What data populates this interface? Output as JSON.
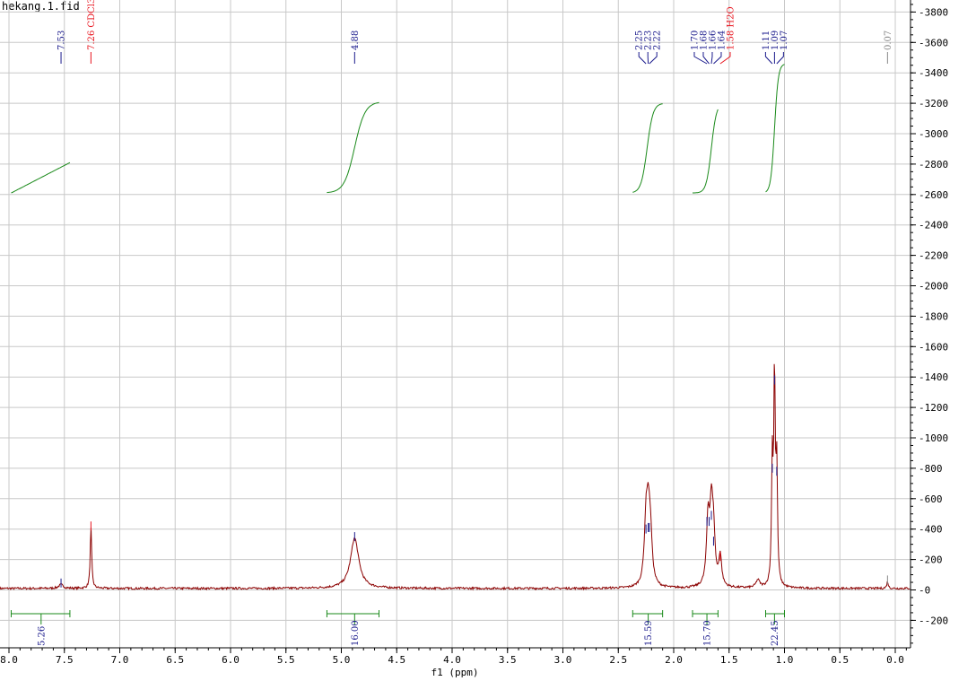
{
  "window_title": "hekang.1.fid",
  "colors": {
    "spectrum": "#8b0000",
    "integral_curve": "#1a8a1a",
    "integral_bar": "#1a8a1a",
    "peak_label_default": "#1a1a8c",
    "peak_label_solvent": "#e8141e",
    "peak_label_reference": "#888888",
    "grid": "#c8c8c8"
  },
  "chart_data": {
    "type": "line",
    "title": "",
    "xlabel": "f1 (ppm)",
    "ylabel": "",
    "xlim": [
      8.05,
      -0.1
    ],
    "ylim": [
      -400,
      3920
    ],
    "x_ticks": [
      "8.0",
      "7.5",
      "7.0",
      "6.5",
      "6.0",
      "5.5",
      "5.0",
      "4.5",
      "4.0",
      "3.5",
      "3.0",
      "2.5",
      "2.0",
      "1.5",
      "1.0",
      "0.5",
      "0.0"
    ],
    "y_ticks": [
      "3800",
      "3600",
      "3400",
      "3200",
      "3000",
      "2800",
      "2600",
      "2400",
      "2200",
      "2000",
      "1800",
      "1600",
      "1400",
      "1200",
      "1000",
      "800",
      "600",
      "400",
      "200",
      "0",
      "-200"
    ],
    "grid": true,
    "peak_labels": [
      {
        "ppm": 7.53,
        "text": "7.53",
        "kind": "default"
      },
      {
        "ppm": 7.26,
        "text": "7.26 CDCl3",
        "kind": "solvent"
      },
      {
        "ppm": 4.88,
        "text": "4.88",
        "kind": "default"
      },
      {
        "ppm": 2.25,
        "text": "2.25",
        "kind": "default"
      },
      {
        "ppm": 2.23,
        "text": "2.23",
        "kind": "default"
      },
      {
        "ppm": 2.22,
        "text": "2.22",
        "kind": "default"
      },
      {
        "ppm": 1.7,
        "text": "1.70",
        "kind": "default"
      },
      {
        "ppm": 1.68,
        "text": "1.68",
        "kind": "default"
      },
      {
        "ppm": 1.66,
        "text": "1.66",
        "kind": "default"
      },
      {
        "ppm": 1.64,
        "text": "1.64",
        "kind": "default"
      },
      {
        "ppm": 1.58,
        "text": "1.58 H2O",
        "kind": "solvent"
      },
      {
        "ppm": 1.11,
        "text": "1.11",
        "kind": "default"
      },
      {
        "ppm": 1.09,
        "text": "1.09",
        "kind": "default"
      },
      {
        "ppm": 1.07,
        "text": "1.07",
        "kind": "default"
      },
      {
        "ppm": 0.07,
        "text": "0.07",
        "kind": "reference"
      }
    ],
    "peaks": [
      {
        "ppm": 7.53,
        "height": 25,
        "width": 0.025
      },
      {
        "ppm": 7.26,
        "height": 400,
        "width": 0.008
      },
      {
        "ppm": 4.88,
        "height": 330,
        "width": 0.045
      },
      {
        "ppm": 2.25,
        "height": 380,
        "width": 0.018
      },
      {
        "ppm": 2.23,
        "height": 390,
        "width": 0.018
      },
      {
        "ppm": 2.21,
        "height": 300,
        "width": 0.018
      },
      {
        "ppm": 1.69,
        "height": 430,
        "width": 0.016
      },
      {
        "ppm": 1.66,
        "height": 470,
        "width": 0.016
      },
      {
        "ppm": 1.64,
        "height": 300,
        "width": 0.016
      },
      {
        "ppm": 1.58,
        "height": 200,
        "width": 0.015
      },
      {
        "ppm": 1.24,
        "height": 50,
        "width": 0.02
      },
      {
        "ppm": 1.11,
        "height": 780,
        "width": 0.008
      },
      {
        "ppm": 1.09,
        "height": 1360,
        "width": 0.008
      },
      {
        "ppm": 1.07,
        "height": 760,
        "width": 0.008
      },
      {
        "ppm": 0.07,
        "height": 45,
        "width": 0.008
      }
    ],
    "baseline": 10,
    "integrals": [
      {
        "from": 7.98,
        "to": 7.45,
        "label_ppm": 7.71,
        "value": "5.26",
        "curve_start": 2610,
        "curve_end": 2810,
        "shape": "linear"
      },
      {
        "from": 5.13,
        "to": 4.66,
        "label_ppm": 4.88,
        "value": "16.00",
        "curve_start": 2610,
        "curve_end": 3210,
        "shape": "sigmoid",
        "center": 4.88
      },
      {
        "from": 2.37,
        "to": 2.1,
        "label_ppm": 2.23,
        "value": "15.59",
        "curve_start": 2610,
        "curve_end": 3200,
        "shape": "sigmoid",
        "center": 2.24
      },
      {
        "from": 1.83,
        "to": 1.6,
        "label_ppm": 1.7,
        "value": "15.70",
        "curve_start": 2610,
        "curve_end": 3200,
        "shape": "sigmoid",
        "center": 1.66
      },
      {
        "from": 1.17,
        "to": 1.0,
        "label_ppm": 1.09,
        "value": "22.45",
        "curve_start": 2610,
        "curve_end": 3460,
        "shape": "sigmoid",
        "center": 1.09
      }
    ]
  }
}
